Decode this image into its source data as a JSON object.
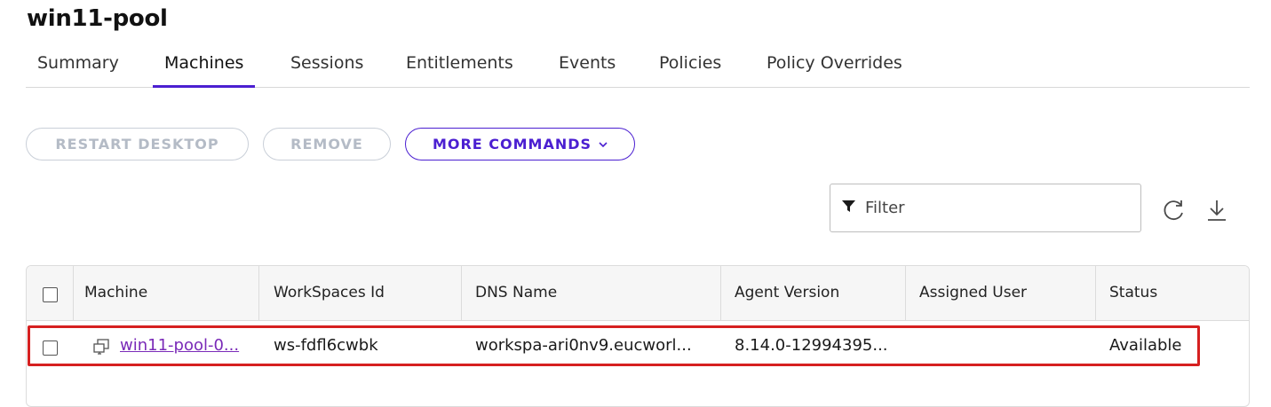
{
  "page": {
    "title": "win11-pool"
  },
  "tabs": [
    {
      "label": "Summary",
      "active": false
    },
    {
      "label": "Machines",
      "active": true
    },
    {
      "label": "Sessions",
      "active": false
    },
    {
      "label": "Entitlements",
      "active": false
    },
    {
      "label": "Events",
      "active": false
    },
    {
      "label": "Policies",
      "active": false
    },
    {
      "label": "Policy Overrides",
      "active": false
    }
  ],
  "toolbar": {
    "restart_label": "RESTART DESKTOP",
    "remove_label": "REMOVE",
    "more_label": "MORE COMMANDS",
    "accent": "#4b1fd1"
  },
  "filter": {
    "placeholder": "Filter",
    "icon": "filter-icon"
  },
  "actions": {
    "refresh_icon": "refresh-icon",
    "download_icon": "download-icon"
  },
  "table": {
    "columns": [
      "Machine",
      "WorkSpaces Id",
      "DNS Name",
      "Agent Version",
      "Assigned User",
      "Status"
    ],
    "rows": [
      {
        "machine": "win11-pool-0...",
        "workspaces_id": "ws-fdfl6cwbk",
        "dns_name": "workspa-ari0nv9.eucworl...",
        "agent_version": "8.14.0-12994395...",
        "assigned_user": "",
        "status": "Available"
      }
    ]
  },
  "highlight_color": "#d62020"
}
